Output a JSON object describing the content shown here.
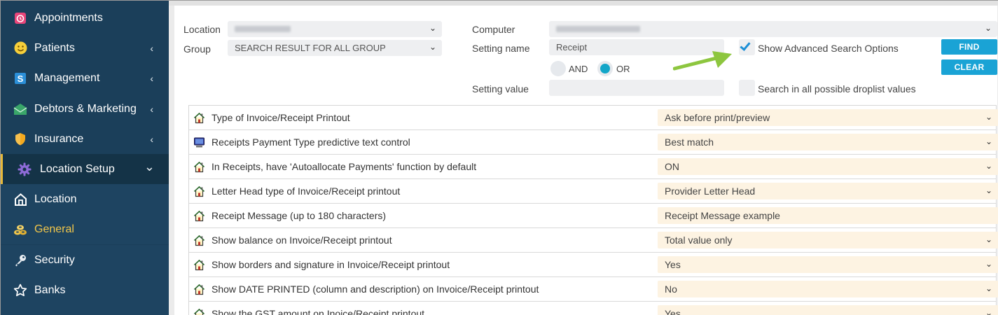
{
  "sidebar": {
    "items": [
      {
        "label": "Appointments",
        "icon": "calendar-icon",
        "chevron": ""
      },
      {
        "label": "Patients",
        "icon": "smiley-icon",
        "chevron": "‹"
      },
      {
        "label": "Management",
        "icon": "dollar-icon",
        "chevron": "‹"
      },
      {
        "label": "Debtors & Marketing",
        "icon": "envelope-icon",
        "chevron": "‹"
      },
      {
        "label": "Insurance",
        "icon": "shield-icon",
        "chevron": "‹"
      },
      {
        "label": "Location Setup",
        "icon": "gear-icon",
        "chevron": "⌄"
      },
      {
        "label": "Location",
        "icon": "house-icon",
        "chevron": ""
      },
      {
        "label": "General",
        "icon": "coins-icon",
        "chevron": ""
      },
      {
        "label": "Security",
        "icon": "key-icon",
        "chevron": ""
      },
      {
        "label": "Banks",
        "icon": "star-icon",
        "chevron": ""
      }
    ]
  },
  "filters": {
    "location_label": "Location",
    "group_label": "Group",
    "group_value": "SEARCH RESULT FOR ALL GROUP",
    "computer_label": "Computer",
    "setting_name_label": "Setting name",
    "setting_name_value": "Receipt",
    "setting_value_label": "Setting value",
    "setting_value_value": "",
    "and_label": "AND",
    "or_label": "OR",
    "advanced_label": "Show Advanced Search Options",
    "droplist_label": "Search in all possible droplist values",
    "find_label": "FIND",
    "clear_label": "CLEAR"
  },
  "colors": {
    "sidebar_bg": "#1b3f5a",
    "accent": "#1aa3d5",
    "highlight": "#f2c64a",
    "value_bg": "#fdf3e2",
    "arrow": "#8dc63f"
  },
  "settings": [
    {
      "label": "Type of Invoice/Receipt Printout",
      "value": "Ask before print/preview",
      "icon": "house-icon",
      "dropdown": true
    },
    {
      "label": "Receipts Payment Type predictive text control",
      "value": "Best match",
      "icon": "computer-icon",
      "dropdown": true
    },
    {
      "label": "In Receipts, have 'Autoallocate Payments' function by default",
      "value": "ON",
      "icon": "house-icon",
      "dropdown": true
    },
    {
      "label": "Letter Head type of Invoice/Receipt printout",
      "value": "Provider Letter Head",
      "icon": "house-icon",
      "dropdown": true
    },
    {
      "label": "Receipt Message (up to 180 characters)",
      "value": "Receipt Message example",
      "icon": "house-icon",
      "dropdown": false
    },
    {
      "label": "Show balance on Invoice/Receipt printout",
      "value": "Total  value only",
      "icon": "house-icon",
      "dropdown": true
    },
    {
      "label": "Show borders and signature in Invoice/Receipt printout",
      "value": "Yes",
      "icon": "house-icon",
      "dropdown": true
    },
    {
      "label": "Show DATE PRINTED (column and description) on Invoice/Receipt printout",
      "value": "No",
      "icon": "house-icon",
      "dropdown": true
    },
    {
      "label": "Show the GST amount on Inoice/Receipt printout",
      "value": "Yes",
      "icon": "house-icon",
      "dropdown": true
    }
  ]
}
